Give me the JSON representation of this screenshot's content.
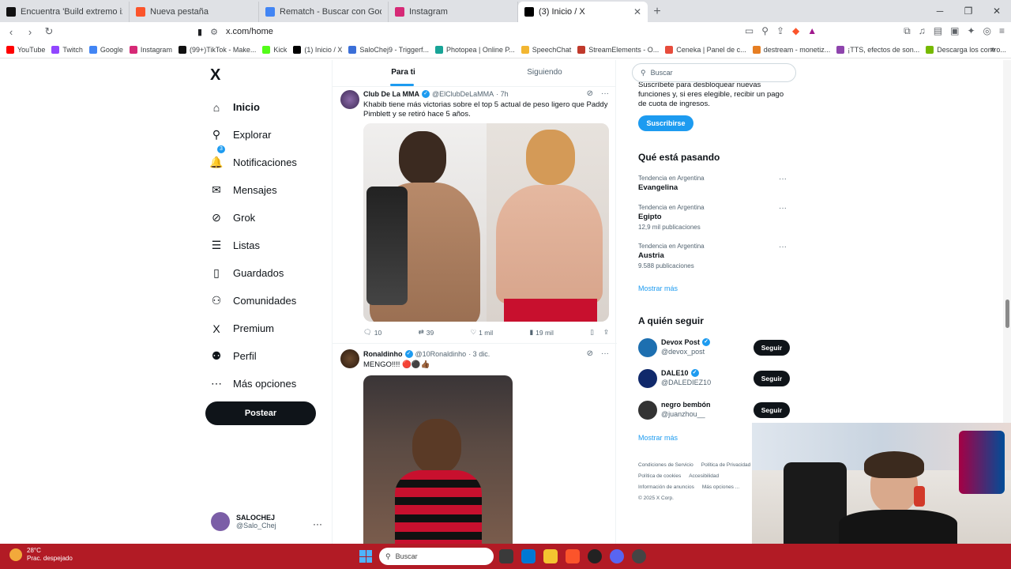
{
  "browser": {
    "tabs": [
      {
        "label": "Encuentra 'Build extremo izquierdo l",
        "icon": "tiktok-icon",
        "color": "#111111"
      },
      {
        "label": "Nueva pestaña",
        "icon": "brave-icon",
        "color": "#fb542b"
      },
      {
        "label": "Rematch - Buscar con Google",
        "icon": "google-icon",
        "color": "#4285f4"
      },
      {
        "label": "Instagram",
        "icon": "instagram-icon",
        "color": "#d62976"
      },
      {
        "label": "(3) Inicio / X",
        "icon": "x-icon",
        "color": "#000000",
        "active": true
      }
    ],
    "new_tab": "+",
    "window_controls": [
      "─",
      "❐",
      "✕"
    ],
    "url": "x.com/home",
    "bookmarks": [
      {
        "label": "YouTube",
        "color": "#ff0000"
      },
      {
        "label": "Twitch",
        "color": "#9146ff"
      },
      {
        "label": "Google",
        "color": "#4285f4"
      },
      {
        "label": "Instagram",
        "color": "#d62976"
      },
      {
        "label": "(99+)TikTok - Make...",
        "color": "#111111"
      },
      {
        "label": "Kick",
        "color": "#53fc18"
      },
      {
        "label": "(1) Inicio / X",
        "color": "#000000"
      },
      {
        "label": "SaloChej9 - Triggerf...",
        "color": "#3b6fd8"
      },
      {
        "label": "Photopea | Online P...",
        "color": "#18a497"
      },
      {
        "label": "SpeechChat",
        "color": "#f2b632"
      },
      {
        "label": "StreamElements - O...",
        "color": "#c0392b"
      },
      {
        "label": "Ceneka | Panel de c...",
        "color": "#e74c3c"
      },
      {
        "label": "destream - monetiz...",
        "color": "#e67e22"
      },
      {
        "label": "¡TTS, efectos de son...",
        "color": "#8e44ad"
      },
      {
        "label": "Descarga los contro...",
        "color": "#76b900"
      }
    ],
    "bookmarks_more": "»"
  },
  "sidebar": {
    "logo": "X",
    "items": [
      {
        "label": "Inicio",
        "icon": "home-icon",
        "glyph": "⌂"
      },
      {
        "label": "Explorar",
        "icon": "search-icon",
        "glyph": "⚲"
      },
      {
        "label": "Notificaciones",
        "icon": "bell-icon",
        "glyph": "🔔"
      },
      {
        "label": "Mensajes",
        "icon": "mail-icon",
        "glyph": "✉"
      },
      {
        "label": "Grok",
        "icon": "grok-icon",
        "glyph": "⊘"
      },
      {
        "label": "Listas",
        "icon": "list-icon",
        "glyph": "☰"
      },
      {
        "label": "Guardados",
        "icon": "bookmark-icon",
        "glyph": "▯"
      },
      {
        "label": "Comunidades",
        "icon": "people-icon",
        "glyph": "⚇"
      },
      {
        "label": "Premium",
        "icon": "x-premium-icon",
        "glyph": "X"
      },
      {
        "label": "Perfil",
        "icon": "person-icon",
        "glyph": "⚉"
      },
      {
        "label": "Más opciones",
        "icon": "more-circle-icon",
        "glyph": "⋯"
      }
    ],
    "notification_badge": "3",
    "post_button": "Postear",
    "profile": {
      "name": "SALOCHEJ",
      "handle": "@Salo_Chej",
      "more": "···"
    }
  },
  "timeline": {
    "tabs": [
      "Para ti",
      "Siguiendo"
    ],
    "tweets": [
      {
        "name": "Club De La MMA",
        "handle": "@ElClubDeLaMMA",
        "time": "· 7h",
        "text": "Khabib tiene más victorias sobre el top 5 actual de peso ligero que Paddy Pimblett y se retiró hace 5 años.",
        "replies": "10",
        "retweets": "39",
        "likes": "1 mil",
        "views": "19 mil"
      },
      {
        "name": "Ronaldinho",
        "handle": "@10Ronaldinho",
        "time": "· 3 dic.",
        "text": "MENGO!!!! 🔴⚫👍🏾"
      }
    ]
  },
  "right": {
    "search_placeholder": "Buscar",
    "premium_text": "Suscríbete para desbloquear nuevas funciones y, si eres elegible, recibir un pago de cuota de ingresos.",
    "subscribe": "Suscribirse",
    "trends_title": "Qué está pasando",
    "trends": [
      {
        "context": "Tendencia en Argentina",
        "name": "Evangelina",
        "count": ""
      },
      {
        "context": "Tendencia en Argentina",
        "name": "Egipto",
        "count": "12,9 mil publicaciones"
      },
      {
        "context": "Tendencia en Argentina",
        "name": "Austria",
        "count": "9.588 publicaciones"
      }
    ],
    "show_more": "Mostrar más",
    "follow_title": "A quién seguir",
    "follow": [
      {
        "name": "Devox Post",
        "handle": "@devox_post",
        "color": "#1d6fb0",
        "verified": true
      },
      {
        "name": "DALE10",
        "handle": "@DALEDIEZ10",
        "color": "#10296b",
        "verified": true
      },
      {
        "name": "negro bembón",
        "handle": "@juanzhou__",
        "color": "#333333",
        "verified": false
      }
    ],
    "follow_button": "Seguir",
    "footer": [
      "Condiciones de Servicio",
      "Política de Privacidad",
      "Política de cookies",
      "Accesibilidad",
      "Información de anuncios",
      "Más opciones ...",
      "© 2025 X Corp."
    ]
  },
  "taskbar": {
    "temp": "28°C",
    "weather": "Prac. despejado",
    "search": "Buscar"
  },
  "colors": {
    "accent": "#1d9bf0",
    "taskbar": "#b21b25"
  }
}
